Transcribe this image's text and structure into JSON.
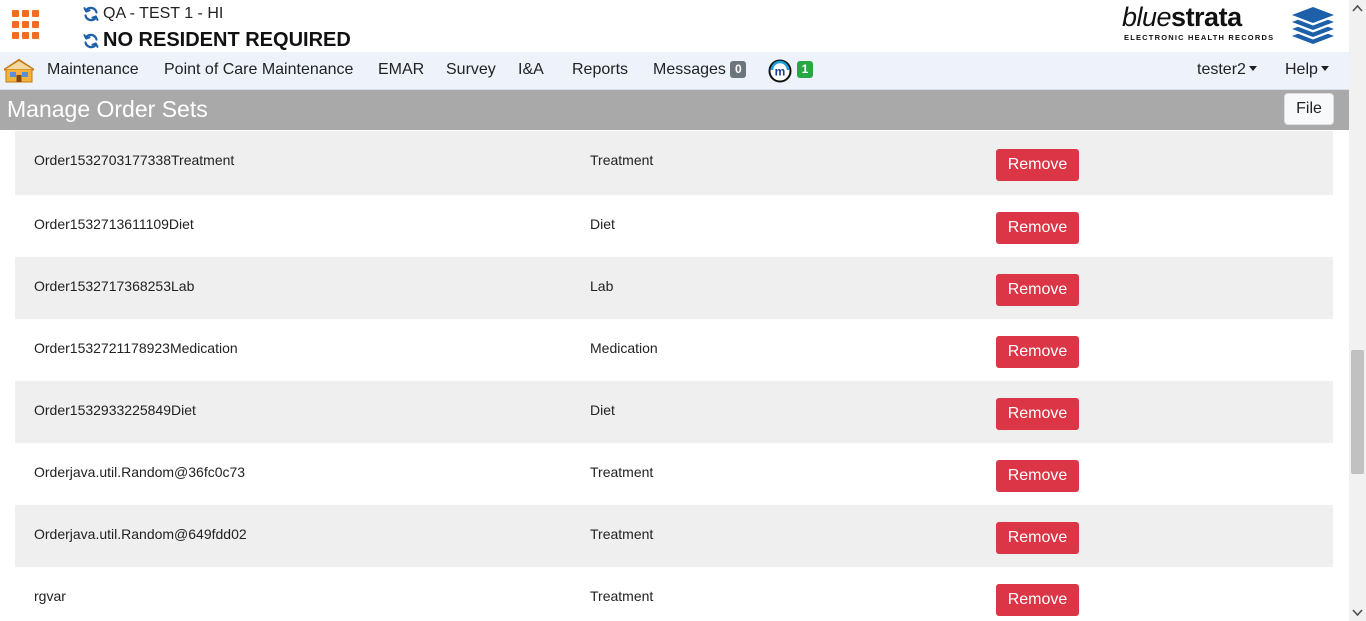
{
  "header": {
    "facility": "QA - TEST 1 - HI",
    "resident": "NO RESIDENT REQUIRED",
    "logo": {
      "light": "blue",
      "bold": "strata",
      "sub": "ELECTRONIC HEALTH RECORDS"
    }
  },
  "nav": {
    "items": [
      {
        "label": "Maintenance"
      },
      {
        "label": "Point of Care Maintenance"
      },
      {
        "label": "EMAR"
      },
      {
        "label": "Survey"
      },
      {
        "label": "I&A"
      },
      {
        "label": "Reports"
      },
      {
        "label": "Messages"
      }
    ],
    "messages_count": "0",
    "m_count": "1",
    "user": "tester2",
    "help": "Help"
  },
  "page": {
    "title": "Manage Order Sets",
    "file_button": "File"
  },
  "rows": [
    {
      "name": "Order1532703177338Treatment",
      "type": "Treatment",
      "action": "Remove"
    },
    {
      "name": "Order1532713611109Diet",
      "type": "Diet",
      "action": "Remove"
    },
    {
      "name": "Order1532717368253Lab",
      "type": "Lab",
      "action": "Remove"
    },
    {
      "name": "Order1532721178923Medication",
      "type": "Medication",
      "action": "Remove"
    },
    {
      "name": "Order1532933225849Diet",
      "type": "Diet",
      "action": "Remove"
    },
    {
      "name": "Orderjava.util.Random@36fc0c73",
      "type": "Treatment",
      "action": "Remove"
    },
    {
      "name": "Orderjava.util.Random@649fdd02",
      "type": "Treatment",
      "action": "Remove"
    },
    {
      "name": "rgvar",
      "type": "Treatment",
      "action": "Remove"
    }
  ],
  "colors": {
    "accent_orange": "#f26d21",
    "remove_red": "#dc3545",
    "header_gray": "#a9a9a9",
    "nav_bg": "#eef3fb",
    "badge_green": "#28a745",
    "badge_gray": "#6c757d",
    "logo_blue": "#1d5fa8"
  },
  "icons": {
    "app_launcher": "grid-icon",
    "sync": "refresh-icon",
    "home": "home-icon",
    "m_app": "m-icon",
    "logo": "layers-icon"
  }
}
